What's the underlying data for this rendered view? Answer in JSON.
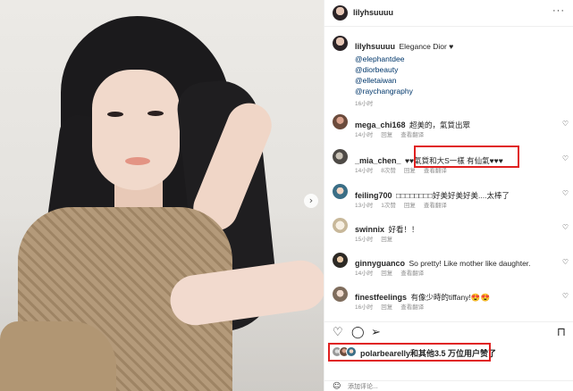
{
  "post": {
    "author": "lilyhsuuuu",
    "caption_author": "lilyhsuuuu",
    "caption_text": "Elegance Dior ♥",
    "mentions": [
      "@elephantdee",
      "@diorbeauty",
      "@elletaiwan",
      "@raychangraphy"
    ],
    "caption_time": "16小时"
  },
  "comments": [
    {
      "user": "mega_chi168",
      "text": "超美的，氣質出眾",
      "time": "14小时",
      "reply": "回复",
      "translate": "查看翻译",
      "likes": ""
    },
    {
      "user": "_mia_chen_",
      "text": "♥♥氣質和大S一樣 有仙氣♥♥♥",
      "time": "14小时",
      "likes": "8次赞",
      "reply": "回复",
      "translate": "查看翻译"
    },
    {
      "user": "feiling700",
      "text": "□□□□□□□□好美好美好美....太棒了",
      "time": "13小时",
      "likes": "1次赞",
      "reply": "回复",
      "translate": "查看翻译"
    },
    {
      "user": "swinnix",
      "text": "好看！！",
      "time": "15小时",
      "reply": "回复",
      "translate": "",
      "likes": ""
    },
    {
      "user": "ginnyguanco",
      "text": "So pretty! Like mother like daughter.",
      "time": "14小时",
      "reply": "回复",
      "translate": "查看翻译",
      "likes": ""
    },
    {
      "user": "finestfeelings",
      "text": "有像少時的tiffany!😍😍",
      "time": "16小时",
      "reply": "回复",
      "translate": "查看翻译",
      "likes": ""
    }
  ],
  "likes": {
    "user": "polarbearelly",
    "text": "和其他3.5 万位用户赞了"
  },
  "add_comment": {
    "placeholder": "添加评论..."
  },
  "icons": {
    "heart": "heart-icon",
    "comment": "comment-icon",
    "share": "share-icon",
    "save": "bookmark-icon",
    "next": "chevron-right-icon"
  },
  "colors": {
    "highlight_box": "#e02020",
    "link": "#00376b",
    "meta": "#8e8e8e"
  }
}
